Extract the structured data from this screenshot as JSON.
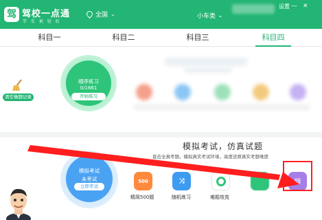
{
  "header": {
    "logo_char": "驾",
    "app_title": "驾校一点通",
    "app_subtitle": "学 车 更 轻 松",
    "region": "全国",
    "car_type": "小车类",
    "settings": "设置",
    "window_buttons": [
      "—",
      "✕"
    ]
  },
  "tabs": [
    {
      "label": "科目一",
      "active": false
    },
    {
      "label": "科目二",
      "active": false
    },
    {
      "label": "科目三",
      "active": false
    },
    {
      "label": "科目四",
      "active": true
    }
  ],
  "practice": {
    "clear_record": "清空做题记录",
    "sequence_title": "顺序练习",
    "sequence_count": "0/1661",
    "start_button": "开始练习"
  },
  "exam": {
    "title": "模拟考试，仿真试题",
    "subtitle": "直击全真考题，模拟真实考试环境，高度还原真实考题难度",
    "mock_title": "模拟考试",
    "mock_status": "未考试",
    "mock_button": "立即考试",
    "tools": [
      {
        "label": "精简500题",
        "icon": "500-icon",
        "text": "500"
      },
      {
        "label": "随机练习",
        "icon": "shuffle-icon",
        "text": "⤨"
      },
      {
        "label": "难题攻克",
        "icon": "target-icon",
        "text": ""
      },
      {
        "label": "",
        "icon": "green-blurred-icon",
        "text": ""
      },
      {
        "label": "",
        "icon": "purple-document-icon",
        "text": "▤"
      }
    ]
  },
  "colors": {
    "brand_green": "#22b573",
    "mock_blue": "#4aa3f2",
    "annotation_red": "#ff1e1e"
  }
}
